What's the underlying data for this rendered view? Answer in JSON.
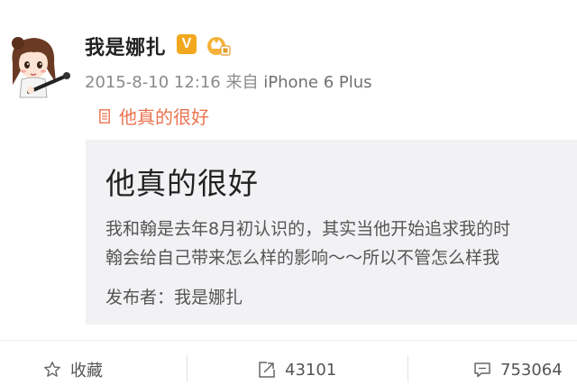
{
  "post": {
    "username": "我是娜扎",
    "verified_mark": "V",
    "timestamp": "2015-8-10 12:16",
    "source_label": "来自",
    "device": "iPhone 6 Plus",
    "article_link_text": "他真的很好"
  },
  "article_card": {
    "title": "他真的很好",
    "excerpt_line1": "我和翰是去年8月初认识的，其实当他开始追求我的时",
    "excerpt_line2": "翰会给自己带来怎么样的影响～～所以不管怎么样我",
    "publisher_label": "发布者：",
    "publisher_name": "我是娜扎"
  },
  "actions": {
    "favorite_label": "收藏",
    "repost_count": "43101",
    "comment_count": "753064"
  },
  "colors": {
    "link": "#eb7350",
    "verified": "#f2a81e",
    "meta_text": "#8a8a8a"
  },
  "icons": {
    "avatar": "cartoon-girl-avatar",
    "verified": "verified-v-icon",
    "member": "crown-member-icon",
    "article": "document-icon",
    "favorite": "star-icon",
    "repost": "repost-icon",
    "comment": "comment-icon"
  }
}
